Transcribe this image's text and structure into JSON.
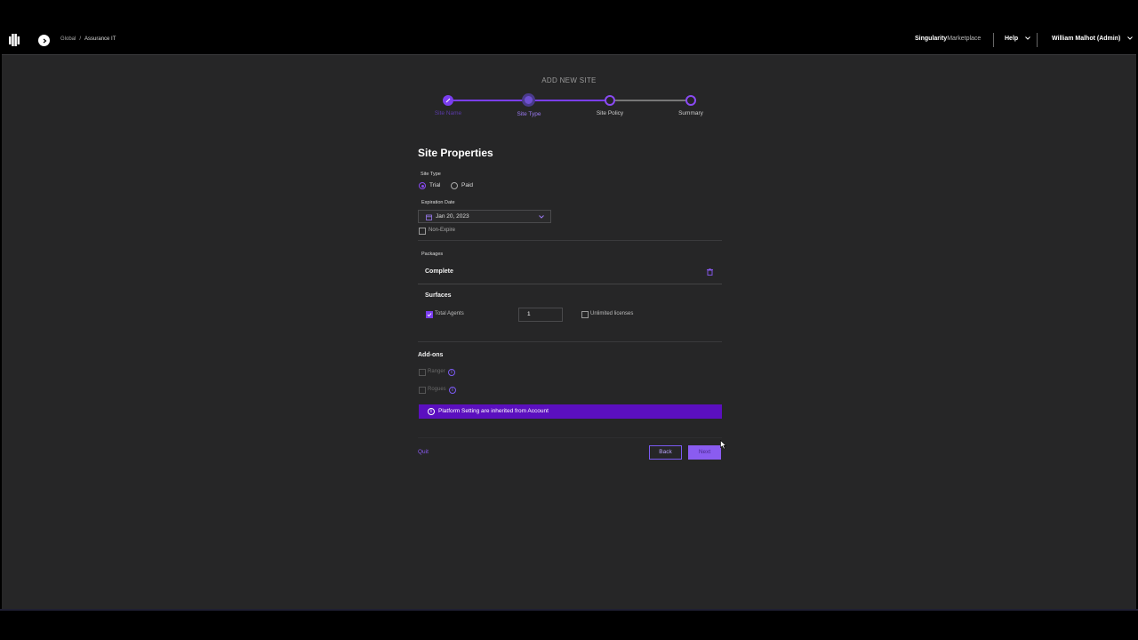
{
  "header": {
    "breadcrumb": [
      "Global",
      "Assurance IT"
    ],
    "marketplace_brand": "Singularity",
    "marketplace_label": "Marketplace",
    "help_label": "Help",
    "user_label": "William Malhot (Admin)"
  },
  "wizard": {
    "title": "ADD NEW SITE",
    "steps": [
      {
        "label": "Site Name",
        "state": "done"
      },
      {
        "label": "Site Type",
        "state": "active"
      },
      {
        "label": "Site Policy",
        "state": "pending"
      },
      {
        "label": "Summary",
        "state": "pending"
      }
    ]
  },
  "form": {
    "section_title": "Site Properties",
    "site_type_label": "Site Type",
    "site_type_options": [
      "Trial",
      "Paid"
    ],
    "site_type_selected": "Trial",
    "expiration_label": "Expiration Date",
    "expiration_value": "Jan 20, 2023",
    "non_expire_label": "Non-Expire",
    "packages_label": "Packages",
    "package_name": "Complete",
    "surfaces_label": "Surfaces",
    "total_agents_label": "Total Agents",
    "total_agents_value": "1",
    "unlimited_label": "Unlimited licenses",
    "addons_label": "Add-ons",
    "addons": [
      "Ranger",
      "Rogues"
    ],
    "banner_text": "Platform Setting are inherited from Account"
  },
  "actions": {
    "quit_label": "Quit",
    "back_label": "Back",
    "next_label": "Next"
  },
  "colors": {
    "accent": "#7b3ef0",
    "banner": "#5b0fbf",
    "panel": "#262627"
  }
}
